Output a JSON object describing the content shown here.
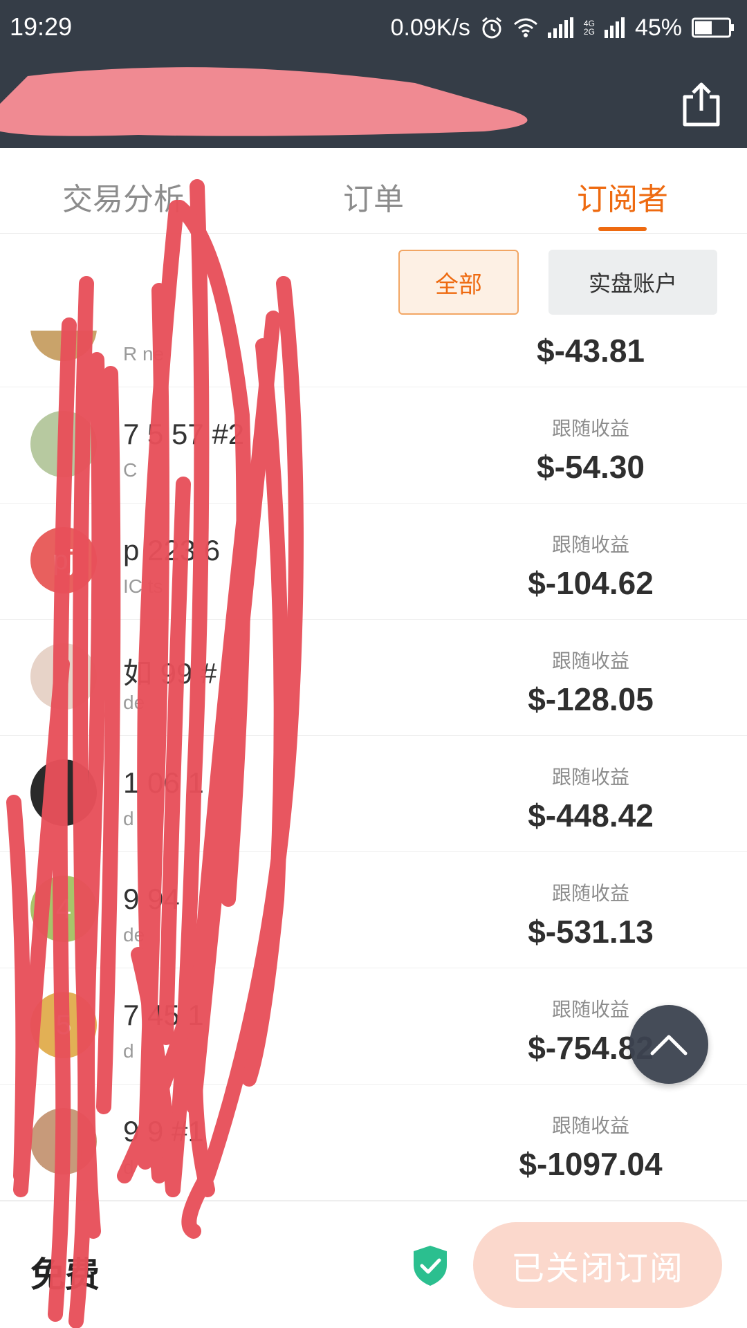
{
  "status_bar": {
    "time": "19:29",
    "network_speed": "0.09K/s",
    "network_types": [
      "4G",
      "2G"
    ],
    "battery": "45%",
    "icons": [
      "alarm-icon",
      "wifi-icon",
      "signal-icon",
      "battery-icon"
    ]
  },
  "header": {
    "title": "",
    "share_icon": "share-icon"
  },
  "tabs": [
    {
      "label": "交易分析",
      "active": false
    },
    {
      "label": "订单",
      "active": false
    },
    {
      "label": "订阅者",
      "active": true
    }
  ],
  "filters": {
    "all": "全部",
    "real_account": "实盘账户"
  },
  "list": {
    "items": [
      {
        "name": "",
        "sub": "R        ne",
        "label": "",
        "value": "$-43.81",
        "avatar_text": "",
        "avatar_color": "#c9a36a"
      },
      {
        "name": "7   5  57 #2",
        "sub": "C",
        "label": "跟随收益",
        "value": "$-54.30",
        "avatar_text": "",
        "avatar_color": "#b7c9a0"
      },
      {
        "name": "p     223    6",
        "sub": "IC      ts",
        "label": "跟随收益",
        "value": "$-104.62",
        "avatar_text": "pj",
        "avatar_color": "#e8605e"
      },
      {
        "name": "如     99   #",
        "sub": "de",
        "label": "跟随收益",
        "value": "$-128.05",
        "avatar_text": "",
        "avatar_color": "#e7d3c8"
      },
      {
        "name": "1      06   1",
        "sub": "d",
        "label": "跟随收益",
        "value": "$-448.42",
        "avatar_text": "",
        "avatar_color": "#2a2a2a"
      },
      {
        "name": "9      94",
        "sub": "de",
        "label": "跟随收益",
        "value": "$-531.13",
        "avatar_text": "4",
        "avatar_color": "#a8c46a"
      },
      {
        "name": "7      45   1",
        "sub": "d",
        "label": "跟随收益",
        "value": "$-754.82",
        "avatar_text": "5",
        "avatar_color": "#e2b055"
      },
      {
        "name": "9      9   #1",
        "sub": "d",
        "label": "跟随收益",
        "value": "$-1097.04",
        "avatar_text": "",
        "avatar_color": "#c79a7a"
      }
    ]
  },
  "back_to_top_icon": "chevron-up-icon",
  "bottom": {
    "price": "免费",
    "shield_icon": "shield-check-icon",
    "button": "已关闭订阅"
  },
  "colors": {
    "accent": "#ee6a10",
    "header_bg": "#353d47",
    "redaction": "#e8505a"
  }
}
